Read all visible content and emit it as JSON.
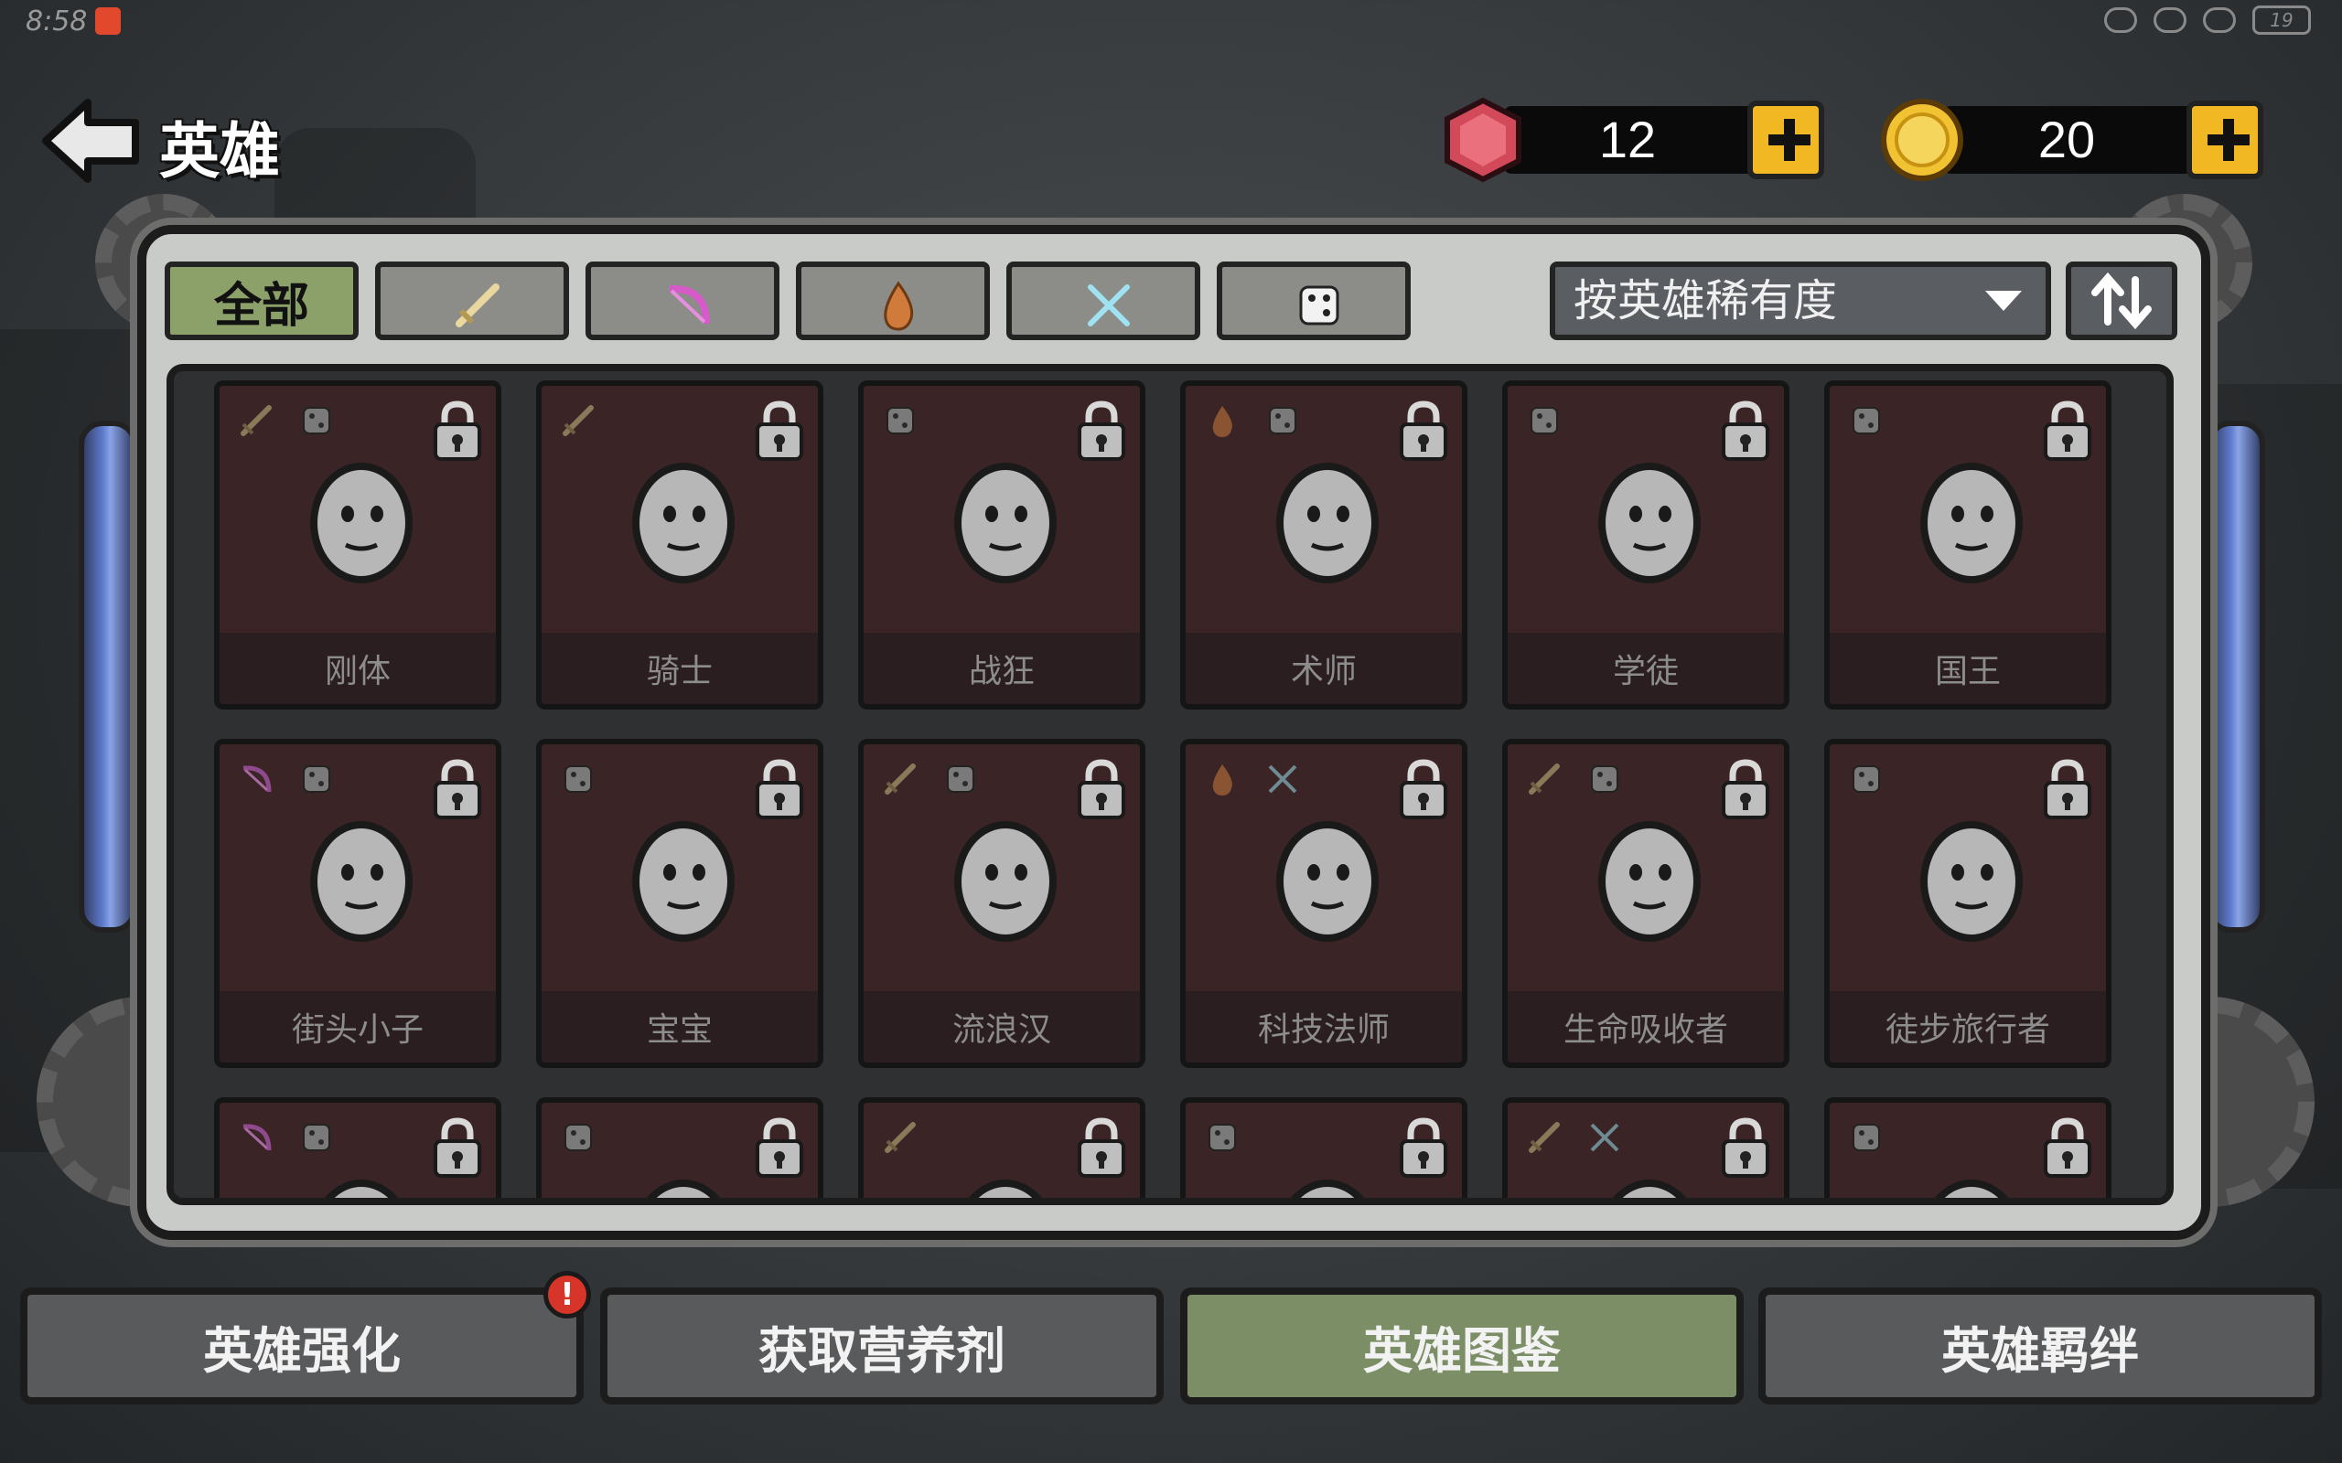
{
  "status_bar": {
    "time": "8:58",
    "battery": "19"
  },
  "header": {
    "title": "英雄"
  },
  "currencies": {
    "gems": {
      "value": "12",
      "icon": "red-gem-icon"
    },
    "coins": {
      "value": "20",
      "icon": "gold-coin-icon"
    }
  },
  "filters": {
    "all_label": "全部",
    "tabs": [
      {
        "icon": "sword-icon"
      },
      {
        "icon": "pink-bow-icon"
      },
      {
        "icon": "flame-icon"
      },
      {
        "icon": "crossed-swords-icon"
      },
      {
        "icon": "dice-icon"
      }
    ]
  },
  "sort": {
    "selected": "按英雄稀有度",
    "order_icon": "sort-order-icon"
  },
  "heroes": [
    {
      "name": "刚体",
      "tags": [
        "sword",
        "dice"
      ],
      "locked": true
    },
    {
      "name": "骑士",
      "tags": [
        "sword"
      ],
      "locked": true
    },
    {
      "name": "战狂",
      "tags": [
        "dice"
      ],
      "locked": true
    },
    {
      "name": "术师",
      "tags": [
        "flame",
        "dice"
      ],
      "locked": true
    },
    {
      "name": "学徒",
      "tags": [
        "dice"
      ],
      "locked": true
    },
    {
      "name": "国王",
      "tags": [
        "dice"
      ],
      "locked": true
    },
    {
      "name": "街头小子",
      "tags": [
        "bow",
        "dice"
      ],
      "locked": true
    },
    {
      "name": "宝宝",
      "tags": [
        "dice"
      ],
      "locked": true
    },
    {
      "name": "流浪汉",
      "tags": [
        "sword",
        "dice"
      ],
      "locked": true
    },
    {
      "name": "科技法师",
      "tags": [
        "flame",
        "cross"
      ],
      "locked": true
    },
    {
      "name": "生命吸收者",
      "tags": [
        "sword",
        "dice"
      ],
      "locked": true
    },
    {
      "name": "徒步旅行者",
      "tags": [
        "dice"
      ],
      "locked": true
    },
    {
      "name": "",
      "tags": [
        "bow",
        "dice"
      ],
      "locked": true
    },
    {
      "name": "",
      "tags": [
        "dice"
      ],
      "locked": true
    },
    {
      "name": "",
      "tags": [
        "sword"
      ],
      "locked": true
    },
    {
      "name": "",
      "tags": [
        "dice"
      ],
      "locked": true
    },
    {
      "name": "",
      "tags": [
        "sword",
        "cross"
      ],
      "locked": true
    },
    {
      "name": "",
      "tags": [
        "dice"
      ],
      "locked": true
    }
  ],
  "bottom_tabs": {
    "enhance": "英雄强化",
    "nutrient": "获取营养剂",
    "codex": "英雄图鉴",
    "bond": "英雄羁绊",
    "enhance_badge": "!"
  },
  "colors": {
    "active_tab": "#8ca06a",
    "card_bg": "#3b2426",
    "coin": "#f1b824",
    "gem": "#d24a5a"
  }
}
